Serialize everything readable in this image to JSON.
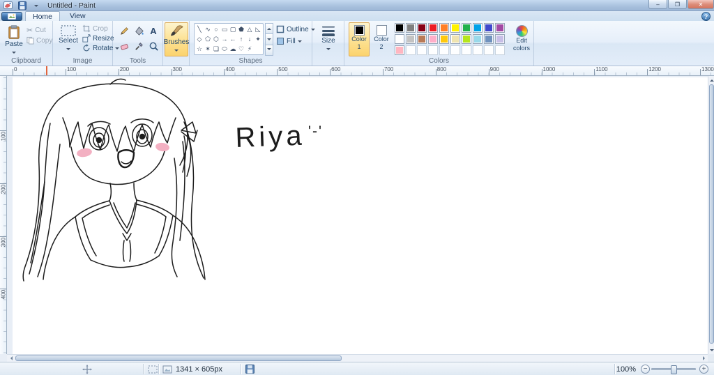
{
  "window": {
    "title": "Untitled - Paint",
    "min_icon": "–",
    "max_icon": "❐",
    "close_icon": "✕",
    "help_icon": "?"
  },
  "tabs": {
    "home": "Home",
    "view": "View"
  },
  "ribbon": {
    "clipboard": {
      "label": "Clipboard",
      "paste": "Paste",
      "cut": "Cut",
      "copy": "Copy",
      "cut_icon": "✂"
    },
    "image": {
      "label": "Image",
      "select": "Select",
      "crop": "Crop",
      "resize": "Resize",
      "rotate": "Rotate"
    },
    "tools": {
      "label": "Tools",
      "text_tool": "A"
    },
    "brushes": {
      "label": "Brushes"
    },
    "shapes": {
      "label": "Shapes",
      "outline": "Outline",
      "fill": "Fill",
      "rows": [
        [
          {
            "name": "line",
            "glyph": "╲"
          },
          {
            "name": "curve",
            "glyph": "∿"
          },
          {
            "name": "ellipse",
            "glyph": "○"
          },
          {
            "name": "rectangle",
            "glyph": "▭"
          },
          {
            "name": "rounded-rectangle",
            "glyph": "▢"
          },
          {
            "name": "polygon",
            "glyph": "⬟"
          },
          {
            "name": "triangle",
            "glyph": "△"
          },
          {
            "name": "right-triangle",
            "glyph": "◺"
          }
        ],
        [
          {
            "name": "diamond",
            "glyph": "◇"
          },
          {
            "name": "pentagon",
            "glyph": "⬠"
          },
          {
            "name": "hexagon",
            "glyph": "⬡"
          },
          {
            "name": "arrow-right",
            "glyph": "→"
          },
          {
            "name": "arrow-left",
            "glyph": "←"
          },
          {
            "name": "arrow-up",
            "glyph": "↑"
          },
          {
            "name": "arrow-down",
            "glyph": "↓"
          },
          {
            "name": "star-four",
            "glyph": "✦"
          }
        ],
        [
          {
            "name": "star-five",
            "glyph": "☆"
          },
          {
            "name": "star-six",
            "glyph": "✶"
          },
          {
            "name": "callout-rect",
            "glyph": "❏"
          },
          {
            "name": "callout-oval",
            "glyph": "⬭"
          },
          {
            "name": "callout-cloud",
            "glyph": "☁"
          },
          {
            "name": "heart",
            "glyph": "♡"
          },
          {
            "name": "lightning",
            "glyph": "⚡"
          }
        ]
      ]
    },
    "size": {
      "label": "Size"
    },
    "colors": {
      "label": "Colors",
      "color1": [
        "Color",
        "1"
      ],
      "color2": [
        "Color",
        "2"
      ],
      "edit": [
        "Edit",
        "colors"
      ],
      "color1_value": "#000000",
      "color2_value": "#ffffff",
      "palette": [
        [
          "#000000",
          "#7f7f7f",
          "#880015",
          "#ed1c24",
          "#ff7f27",
          "#fff200",
          "#22b14c",
          "#00a2e8",
          "#3f48cc",
          "#a349a4"
        ],
        [
          "#ffffff",
          "#c3c3c3",
          "#b97a57",
          "#ffaec9",
          "#ffc90e",
          "#efe4b0",
          "#b5e61d",
          "#99d9ea",
          "#7092be",
          "#c8bfe7"
        ],
        [
          "#ffb6c1",
          "",
          "",
          "",
          "",
          "",
          "",
          "",
          "",
          ""
        ]
      ]
    }
  },
  "ruler": {
    "h_labels": [
      "0",
      "100",
      "200",
      "300",
      "400",
      "500",
      "600",
      "700",
      "800",
      "900",
      "1000",
      "1100",
      "1200",
      "1300"
    ],
    "v_labels": [
      "100",
      "200",
      "300",
      "400"
    ]
  },
  "canvas": {
    "text_main": "Riya",
    "text_face": "'-'",
    "ink": "#1c1c1c",
    "blush": "#f2a3b8"
  },
  "statusbar": {
    "dimensions": "1341 × 605px",
    "zoom": "100%"
  }
}
